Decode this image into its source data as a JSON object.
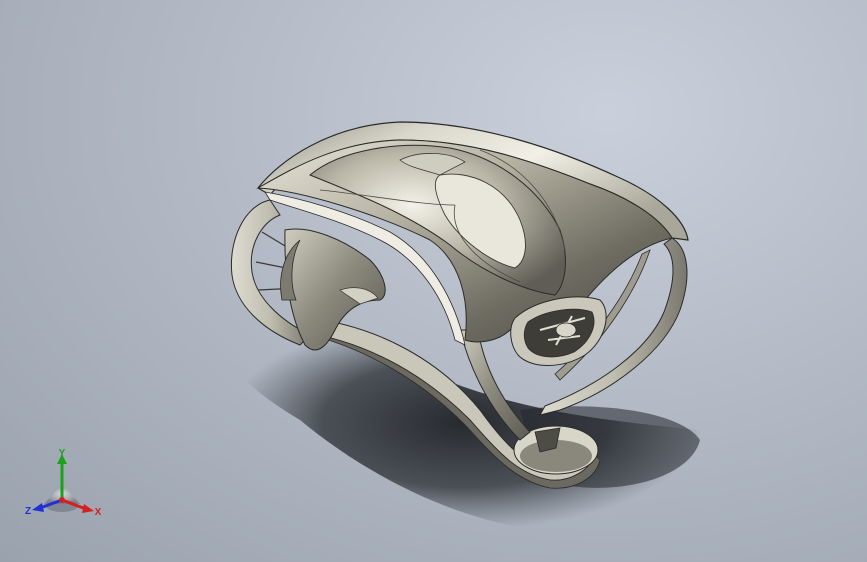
{
  "viewport": {
    "background_top": "#c9d0db",
    "background_bottom": "#9aa2ae",
    "model_color": "#9c9a8c"
  },
  "triad": {
    "x_label": "X",
    "y_label": "Y",
    "z_label": "Z",
    "x_color": "#d42020",
    "y_color": "#19a319",
    "z_color": "#2030d8"
  }
}
